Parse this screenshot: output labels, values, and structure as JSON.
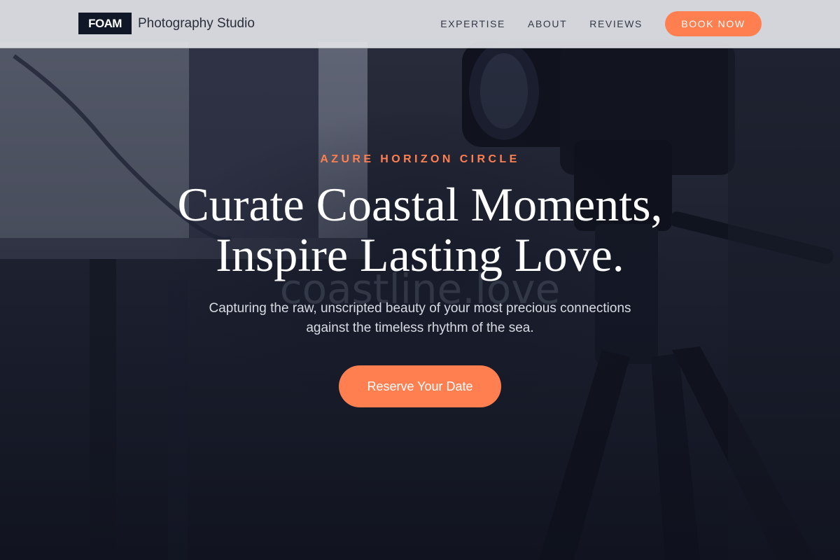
{
  "header": {
    "brand_mark": "FOAM",
    "brand_name": "Photography Studio",
    "nav": [
      {
        "label": "EXPERTISE"
      },
      {
        "label": "ABOUT"
      },
      {
        "label": "REVIEWS"
      }
    ],
    "cta_label": "BOOK NOW"
  },
  "hero": {
    "eyebrow": "AZURE HORIZON CIRCLE",
    "headline_line1": "Curate Coastal Moments,",
    "headline_line2": "Inspire Lasting Love.",
    "watermark": "coastline.love",
    "subtitle": "Capturing the raw, unscripted beauty of your most precious connections against the timeless rhythm of the sea.",
    "cta_label": "Reserve Your Date",
    "background_image": "camera-on-tripod-photo"
  },
  "colors": {
    "accent": "#ff7f50",
    "brand_dark": "#101828",
    "header_bg": "#e0e2e6",
    "hero_overlay": "#141826"
  }
}
